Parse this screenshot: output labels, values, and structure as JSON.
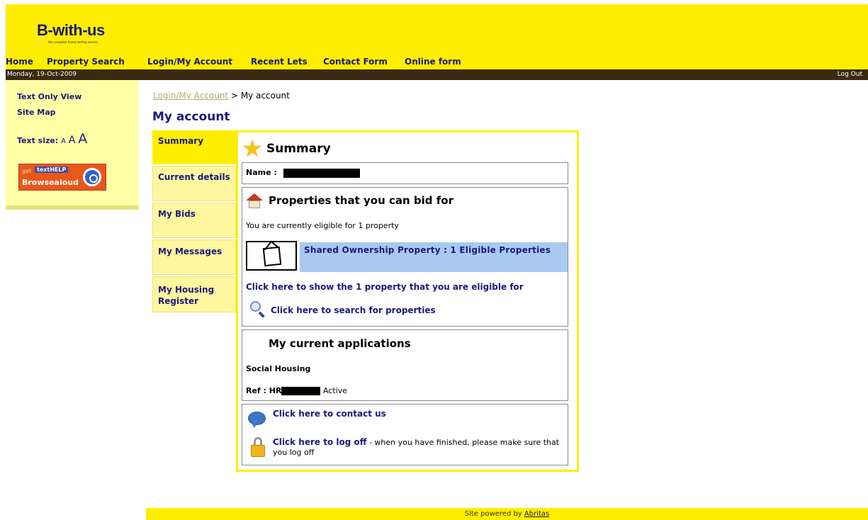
{
  "logo": {
    "text": "B-with-us",
    "tagline": "the complete home renting service"
  },
  "nav": {
    "items": [
      {
        "label": "Home"
      },
      {
        "label": "Property Search"
      },
      {
        "label": "Login/My Account"
      },
      {
        "label": "Recent Lets"
      },
      {
        "label": "Contact Form"
      },
      {
        "label": "Online form"
      }
    ]
  },
  "datebar": {
    "date": "Monday, 19-Oct-2009",
    "logout": "Log Out"
  },
  "sidebar": {
    "text_only": "Text Only View",
    "site_map": "Site Map",
    "text_size_label": "Text size:",
    "sizes": [
      "A",
      "A",
      "A"
    ],
    "browsealoud": {
      "get": "get",
      "texthelp": "textHELP",
      "label": "Browsealoud"
    }
  },
  "breadcrumb": {
    "link": "Login/My Account",
    "sep": " > ",
    "current": "My account"
  },
  "page_title": "My account",
  "tabs": [
    {
      "label": "Summary",
      "active": true
    },
    {
      "label": "Current details"
    },
    {
      "label": "My Bids"
    },
    {
      "label": "My Messages"
    },
    {
      "label": "My Housing Register"
    }
  ],
  "summary": {
    "title": "Summary",
    "name_label": "Name :",
    "properties": {
      "heading": "Properties that you can bid for",
      "eligible_text": "You are currently eligible for 1 property",
      "band_text": "Shared Ownership Property : 1 Eligible Properties",
      "show_link": "Click here to show the 1 property that you are eligible for",
      "search_link": "Click here to search for properties"
    },
    "applications": {
      "heading": "My current applications",
      "type": "Social Housing",
      "ref_label": "Ref : HR",
      "status": "Active"
    },
    "contact": {
      "contact_link": "Click here to contact us",
      "logoff_link": "Click here to log off",
      "logoff_note": "- when you have finished, please make sure that you log off"
    }
  },
  "footer": {
    "text": "Site powered by",
    "link": "Abritas"
  },
  "colors": {
    "yellow": "#ffee00",
    "light_yellow": "#ffffa6",
    "navy": "#1a1a7a",
    "date_bar": "#3b2a12",
    "band_blue": "#a9c9f0"
  }
}
